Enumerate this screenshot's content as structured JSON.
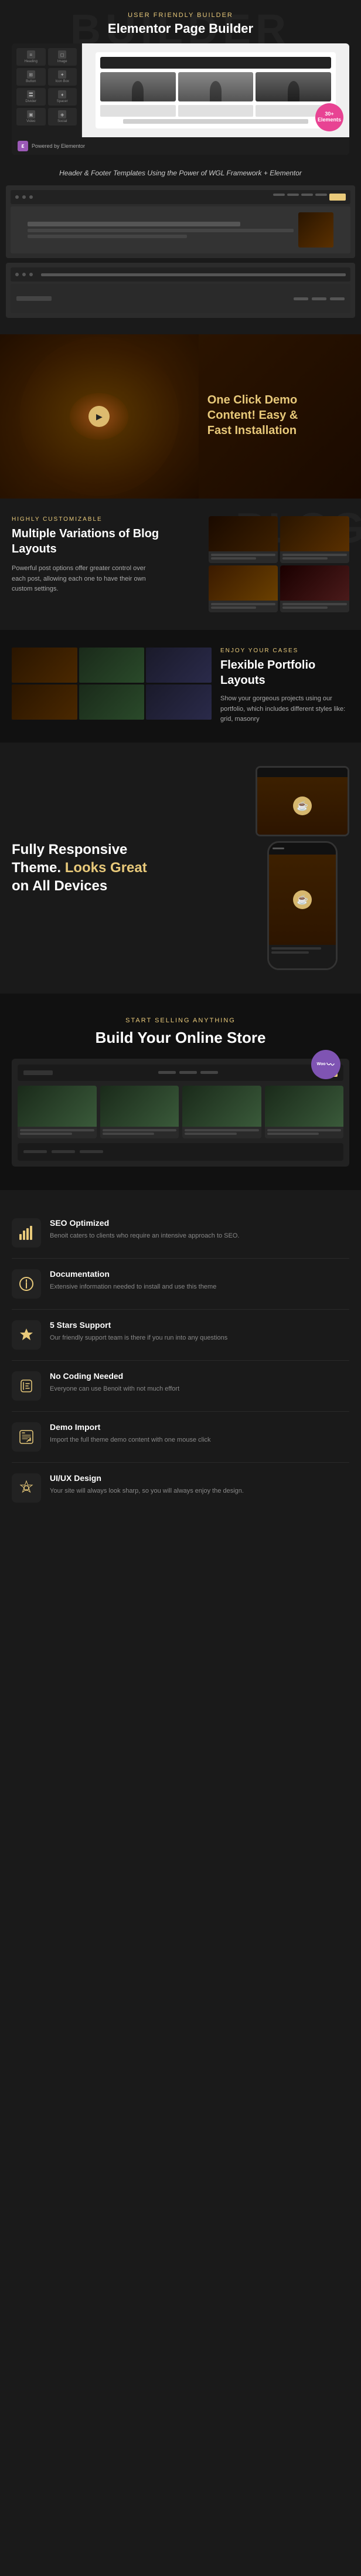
{
  "builder": {
    "bg_text": "BUILDER",
    "subtitle": "User Friendly Builder",
    "title": "Elementor Page Builder",
    "footer_text": "Header & Footer Templates Using the Power of WGL Framework + Elementor",
    "badge_text": "30+",
    "badge_subtext": "Elements",
    "elementor_label": "ε",
    "widgets": [
      {
        "icon": "≡",
        "label": "Heading"
      },
      {
        "icon": "◻",
        "label": "Image"
      },
      {
        "icon": "⊞",
        "label": "Button"
      },
      {
        "icon": "✦",
        "label": "Icon Box"
      },
      {
        "icon": "〓",
        "label": "Divider"
      },
      {
        "icon": "♦",
        "label": "Spacer"
      },
      {
        "icon": "▣",
        "label": "Video"
      },
      {
        "icon": "◈",
        "label": "Social"
      }
    ]
  },
  "demo": {
    "title_part1": "One Click Demo",
    "title_part2": "Content! Easy &",
    "title_part3": "Fast Installation",
    "play_icon": "▶"
  },
  "blog": {
    "subtitle": "Highly Customizable",
    "bg_text": "BLOG",
    "title": "Multiple Variations of Blog Layouts",
    "description": "Powerful post options offer greater control over each post, allowing each one to have their own custom settings."
  },
  "portfolio": {
    "subtitle": "Enjoy Your Cases",
    "title": "Flexible Portfolio Layouts",
    "description": "Show your gorgeous projects using our portfolio, which includes different styles like: grid, masonry"
  },
  "responsive": {
    "title_line1": "Fully Responsive",
    "title_line2": "Theme. Looks Great",
    "title_line3": "on All Devices",
    "coffee_icon": "☕"
  },
  "store": {
    "subtitle": "Start Selling Anything",
    "title": "Build Your Online Store",
    "woo_text": "Woo"
  },
  "features": [
    {
      "id": "seo",
      "icon": "📊",
      "title": "SEO Optimized",
      "description": "Benoit caters to clients who require an intensive approach to SEO."
    },
    {
      "id": "docs",
      "icon": "📄",
      "title": "Documentation",
      "description": "Extensive information needed to install and use this theme"
    },
    {
      "id": "support",
      "icon": "⭐",
      "title": "5 Stars Support",
      "description": "Our friendly support team is there if you run into any questions"
    },
    {
      "id": "coding",
      "icon": "☁",
      "title": "No Coding Needed",
      "description": "Everyone can use Benoit with not much effort"
    },
    {
      "id": "demo-import",
      "icon": "⌨",
      "title": "Demo Import",
      "description": "Import the full theme demo content with one mouse click"
    },
    {
      "id": "uiux",
      "icon": "✦",
      "title": "UI/UX Design",
      "description": "Your site will always look sharp, so you will always enjoy the design."
    }
  ]
}
